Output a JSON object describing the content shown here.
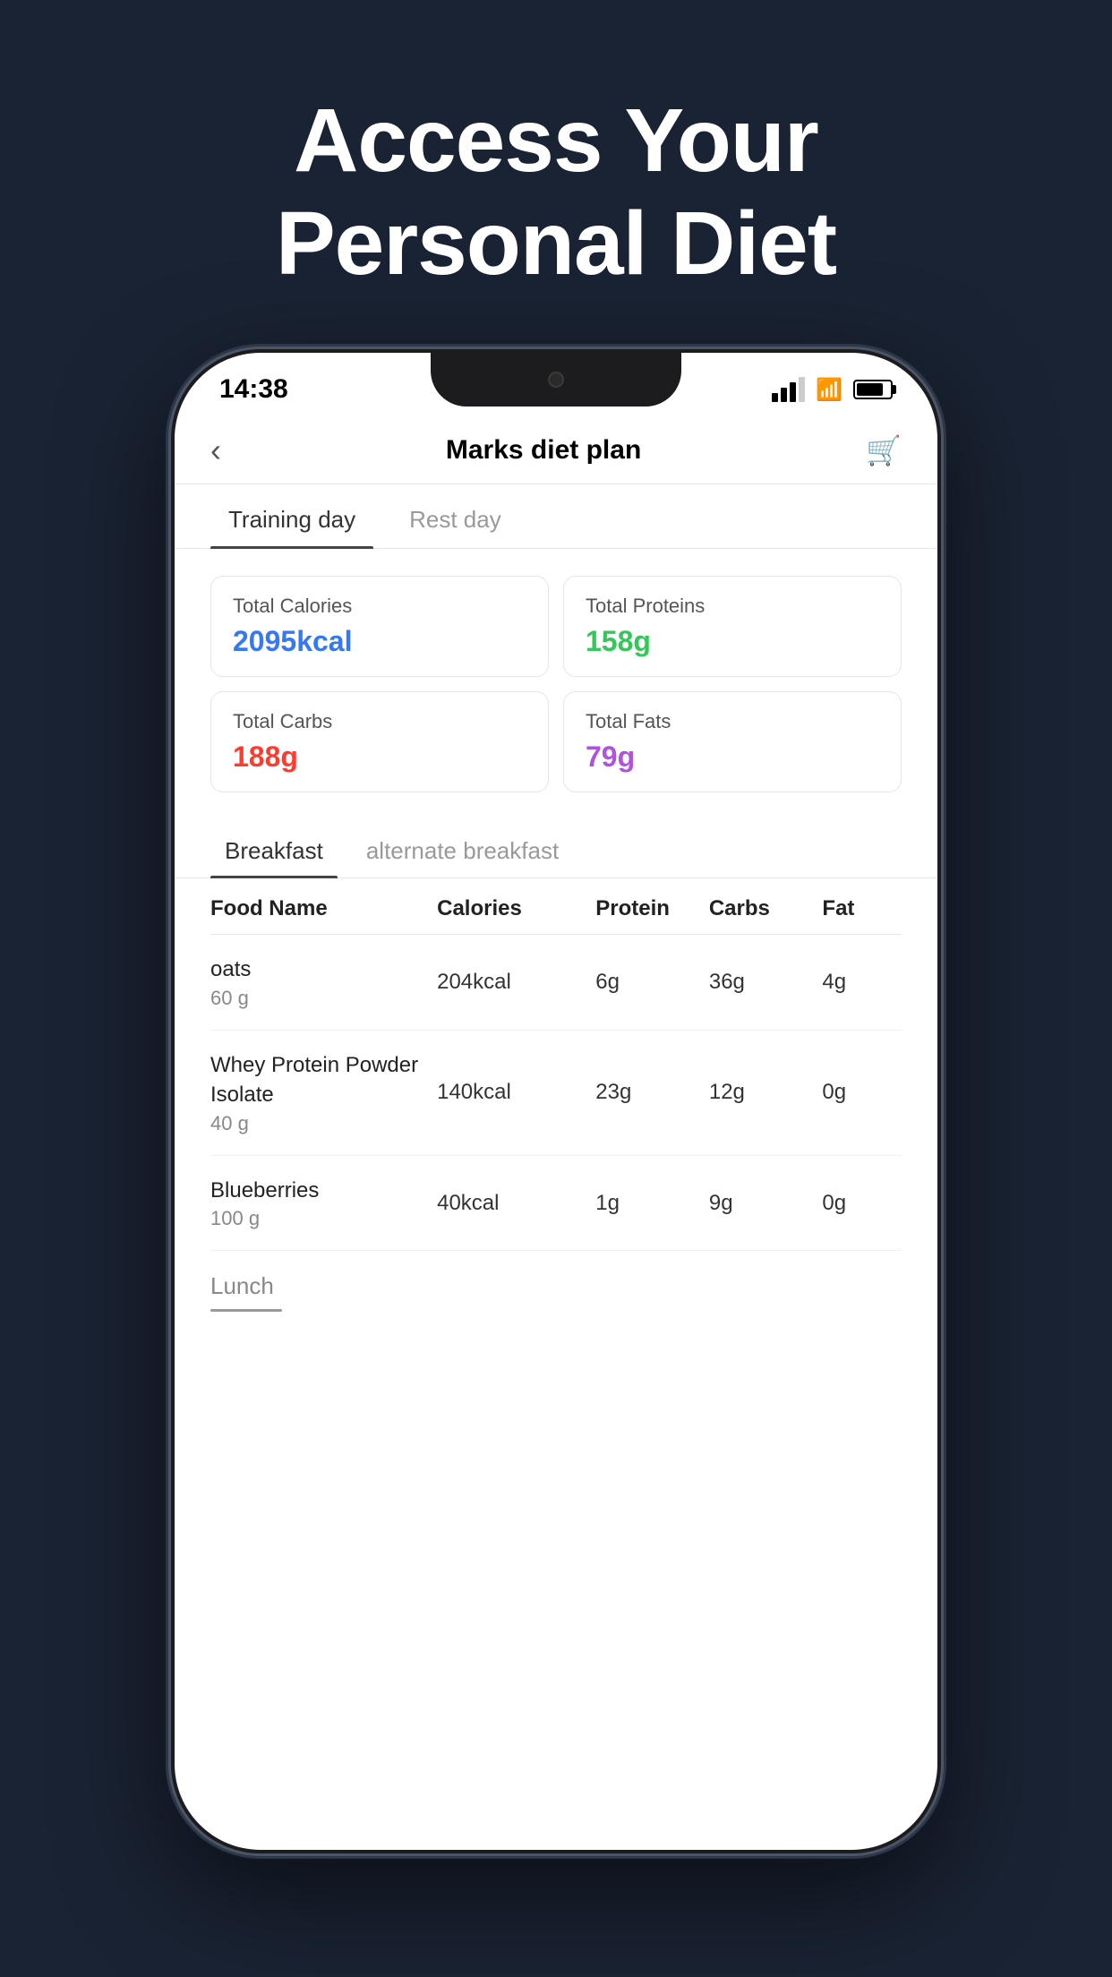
{
  "hero": {
    "title_line1": "Access Your",
    "title_line2": "Personal Diet"
  },
  "status_bar": {
    "time": "14:38",
    "signal_label": "signal-icon",
    "wifi_label": "wifi-icon",
    "battery_label": "battery-icon"
  },
  "header": {
    "back_label": "‹",
    "title": "Marks diet plan",
    "cart_label": "🛒"
  },
  "day_tabs": [
    {
      "label": "Training day",
      "active": true
    },
    {
      "label": "Rest day",
      "active": false
    }
  ],
  "stats": {
    "total_calories_label": "Total Calories",
    "total_calories_value": "2095kcal",
    "total_proteins_label": "Total Proteins",
    "total_proteins_value": "158g",
    "total_carbs_label": "Total Carbs",
    "total_carbs_value": "188g",
    "total_fats_label": "Total Fats",
    "total_fats_value": "79g"
  },
  "meal_tabs": [
    {
      "label": "Breakfast",
      "active": true
    },
    {
      "label": "alternate breakfast",
      "active": false
    }
  ],
  "table": {
    "headers": [
      "Food Name",
      "Calories",
      "Protein",
      "Carbs",
      "Fat"
    ],
    "rows": [
      {
        "name": "oats",
        "amount": "60 g",
        "calories": "204kcal",
        "protein": "6g",
        "carbs": "36g",
        "fat": "4g"
      },
      {
        "name": "Whey Protein Powder Isolate",
        "amount": "40 g",
        "calories": "140kcal",
        "protein": "23g",
        "carbs": "12g",
        "fat": "0g"
      },
      {
        "name": "Blueberries",
        "amount": "100 g",
        "calories": "40kcal",
        "protein": "1g",
        "carbs": "9g",
        "fat": "0g"
      }
    ]
  },
  "lunch_section": {
    "label": "Lunch"
  }
}
